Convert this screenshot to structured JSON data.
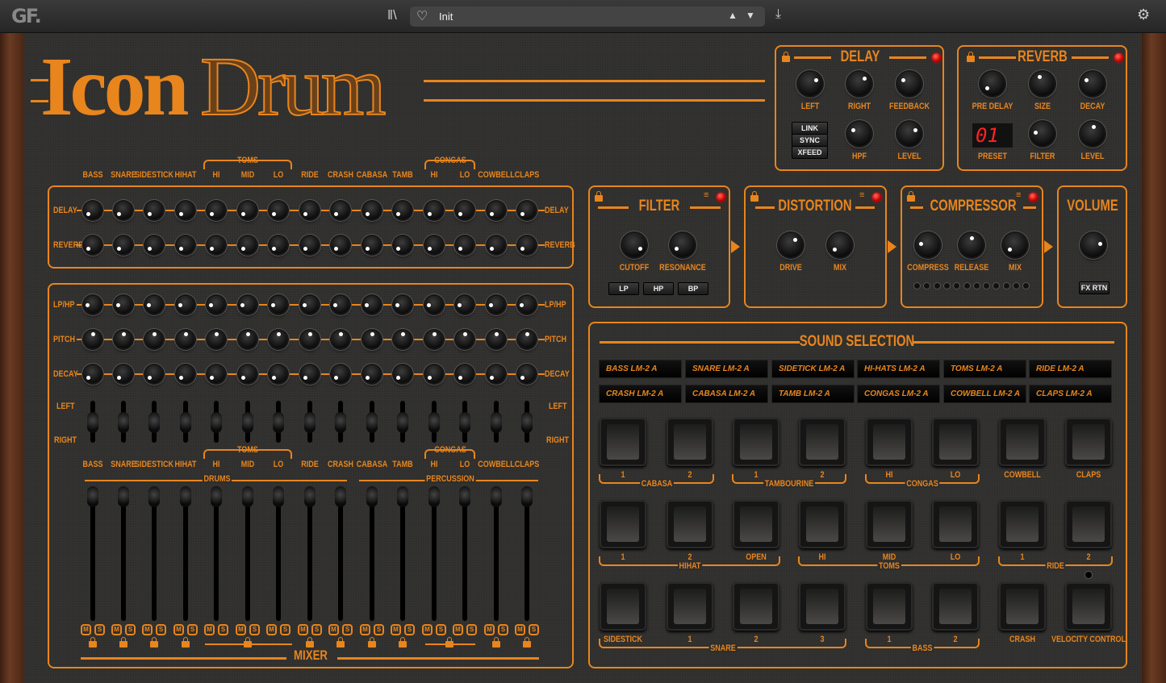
{
  "topbar": {
    "logo": "GF.",
    "preset_name": "Init",
    "icons": [
      "library-icon",
      "heart-icon",
      "up-arrow-icon",
      "down-arrow-icon",
      "save-icon",
      "gear-icon"
    ]
  },
  "logo": {
    "word1": "Icon",
    "word2": "Drum"
  },
  "accent_color": "#e8851d",
  "channels": [
    "BASS",
    "SNARE",
    "SIDESTICK",
    "HIHAT",
    "HI",
    "MID",
    "LO",
    "RIDE",
    "CRASH",
    "CABASA",
    "TAMB",
    "HI",
    "LO",
    "COWBELL",
    "CLAPS"
  ],
  "channel_groups": {
    "toms": "TOMS",
    "congas": "CONGAS"
  },
  "sends": {
    "delay": "DELAY",
    "reverb": "REVERB"
  },
  "mixer": {
    "lphp": "LP/HP",
    "pitch": "PITCH",
    "decay": "DECAY",
    "left": "LEFT",
    "right": "RIGHT",
    "drums": "DRUMS",
    "percussion": "PERCUSSION",
    "title": "MIXER",
    "mute": "M",
    "solo": "S"
  },
  "delay": {
    "title": "DELAY",
    "knobs": [
      "LEFT",
      "RIGHT",
      "FEEDBACK",
      "HPF",
      "LEVEL"
    ],
    "buttons": [
      "LINK",
      "SYNC",
      "XFEED"
    ]
  },
  "reverb": {
    "title": "REVERB",
    "knobs": [
      "PRE DELAY",
      "SIZE",
      "DECAY",
      "FILTER",
      "LEVEL"
    ],
    "preset_label": "PRESET",
    "preset_value": "01"
  },
  "filter": {
    "title": "FILTER",
    "knobs": [
      "CUTOFF",
      "RESONANCE"
    ],
    "buttons": [
      "LP",
      "HP",
      "BP"
    ]
  },
  "distortion": {
    "title": "DISTORTION",
    "knobs": [
      "DRIVE",
      "MIX"
    ]
  },
  "compressor": {
    "title": "COMPRESSOR",
    "knobs": [
      "COMPRESS",
      "RELEASE",
      "MIX"
    ]
  },
  "volume": {
    "title": "VOLUME",
    "button": "FX RTN"
  },
  "sound_selection": {
    "title": "SOUND SELECTION",
    "displays": [
      "BASS LM-2 A",
      "SNARE LM-2 A",
      "SIDETICK LM-2 A",
      "HI-HATS LM-2 A",
      "TOMS LM-2 A",
      "RIDE LM-2 A",
      "CRASH LM-2 A",
      "CABASA LM-2 A",
      "TAMB LM-2 A",
      "CONGAS LM-2 A",
      "COWBELL LM-2 A",
      "CLAPS LM-2 A"
    ],
    "rows": [
      {
        "labels": [
          "1",
          "2",
          "1",
          "2",
          "HI",
          "LO",
          "COWBELL",
          "CLAPS"
        ],
        "groups": [
          "CABASA",
          "TAMBOURINE",
          "CONGAS"
        ]
      },
      {
        "labels": [
          "1",
          "2",
          "OPEN",
          "HI",
          "MID",
          "LO",
          "1",
          "2"
        ],
        "groups": [
          "HIHAT",
          "TOMS",
          "RIDE"
        ]
      },
      {
        "labels": [
          "SIDESTICK",
          "1",
          "2",
          "3",
          "1",
          "2",
          "CRASH",
          "VELOCITY CONTROL"
        ],
        "groups": [
          "SNARE",
          "BASS"
        ]
      }
    ]
  }
}
